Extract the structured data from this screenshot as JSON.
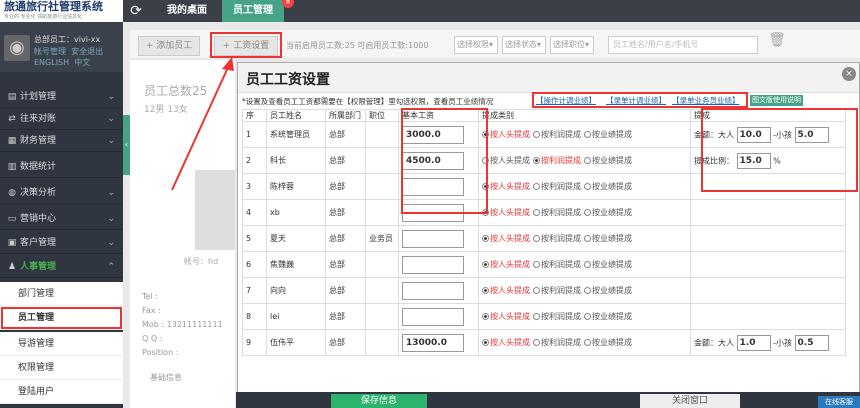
{
  "app": {
    "logo": "旅通旅行社管理系统",
    "logo_sub": "专业的·专业化 领航旅游行业信息化",
    "tabs": [
      "我的桌面",
      "员工管理"
    ]
  },
  "user": {
    "label": "总部员工：vivi-xx",
    "account": "帐号管理",
    "logout": "安全退出",
    "lang_en": "ENGLISH",
    "lang_cn": "中文"
  },
  "sidebar": {
    "menus": [
      "计划管理",
      "往来对账",
      "财务管理",
      "数据统计",
      "决策分析",
      "营销中心",
      "客户管理",
      "人事管理"
    ],
    "submenus": [
      "部门管理",
      "员工管理",
      "导游管理",
      "权限管理",
      "登陆用户"
    ]
  },
  "toolbar": {
    "add": "+ 添加员工",
    "salary": "+ 工资设置",
    "stat": "当前启用员工数:25 可启用员工数:1000",
    "selects": [
      "选择权限",
      "选择状态",
      "选择职位"
    ],
    "search_placeholder": "员工姓名/用户名/手机号"
  },
  "card": {
    "title": "员工总数25",
    "sub": "12男 13女",
    "account": "帐号：hd",
    "tel": "Tel :",
    "fax": "Fax :",
    "mob": "Mob : 13211111111",
    "qq": "Q Q :",
    "position": "Position :",
    "nav": "基础信息"
  },
  "modal": {
    "title": "员工工资设置",
    "close": "×",
    "notice": "*设置及查看员工工资都需要在【权限管理】里勾选权限，查看员工业绩情况",
    "links": [
      "操作计调业绩",
      "录单计调业绩",
      "录单业务员业绩"
    ],
    "manual": "图文版使用说明",
    "headers": [
      "序",
      "员工姓名",
      "所属部门",
      "职位",
      "基本工资",
      "提成类别",
      "提成"
    ],
    "mode_labels": [
      "按人头提成",
      "按利润提成",
      "按业绩提成"
    ],
    "adult_label": "金额：大人",
    "child_label": "小孩",
    "ratio_label": "提成比例：",
    "percent": "%",
    "rows": [
      {
        "no": "1",
        "name": "系统管理员",
        "dept": "总部",
        "pos": "",
        "base": "3000.0",
        "mode": 0,
        "type": "amount",
        "adult": "10.0",
        "child": "5.0"
      },
      {
        "no": "2",
        "name": "科长",
        "dept": "总部",
        "pos": "",
        "base": "4500.0",
        "mode": 1,
        "type": "ratio",
        "ratio": "15.0"
      },
      {
        "no": "3",
        "name": "陈梓蓉",
        "dept": "总部",
        "pos": "",
        "base": "",
        "mode": 0,
        "type": "none"
      },
      {
        "no": "4",
        "name": "xb",
        "dept": "总部",
        "pos": "",
        "base": "",
        "mode": 0,
        "type": "none"
      },
      {
        "no": "5",
        "name": "夏天",
        "dept": "总部",
        "pos": "业务员",
        "base": "",
        "mode": 0,
        "type": "none"
      },
      {
        "no": "6",
        "name": "焦魏巍",
        "dept": "总部",
        "pos": "",
        "base": "",
        "mode": 0,
        "type": "none"
      },
      {
        "no": "7",
        "name": "向向",
        "dept": "总部",
        "pos": "",
        "base": "",
        "mode": 0,
        "type": "none"
      },
      {
        "no": "8",
        "name": "lei",
        "dept": "总部",
        "pos": "",
        "base": "",
        "mode": 0,
        "type": "none"
      },
      {
        "no": "9",
        "name": "伍伟平",
        "dept": "总部",
        "pos": "",
        "base": "13000.0",
        "mode": 0,
        "type": "amount",
        "adult": "1.0",
        "child": "0.5"
      }
    ],
    "save": "保存信息",
    "close_btn": "关闭窗口"
  },
  "online": "在线客服"
}
